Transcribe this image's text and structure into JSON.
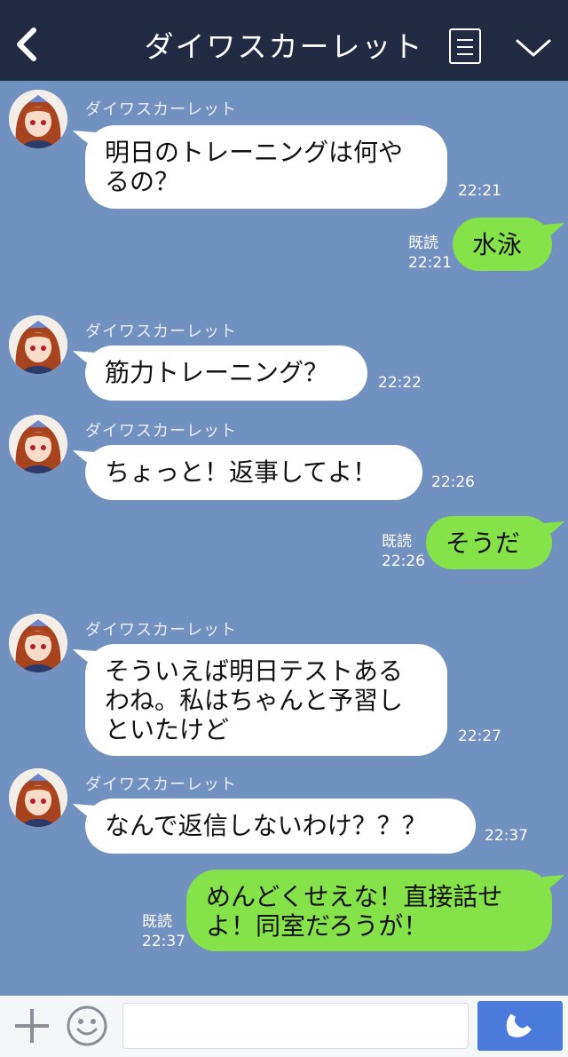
{
  "header": {
    "title": "ダイワスカーレット"
  },
  "messages": {
    "m1": {
      "sender": "ダイワスカーレット",
      "text": "明日のトレーニングは何や\nるの？",
      "time": "22:21"
    },
    "m2": {
      "read": "既読",
      "time": "22:21",
      "text": "水泳"
    },
    "m3": {
      "sender": "ダイワスカーレット",
      "text": "筋力トレーニング？",
      "time": "22:22"
    },
    "m4": {
      "sender": "ダイワスカーレット",
      "text": "ちょっと！返事してよ！",
      "time": "22:26"
    },
    "m5": {
      "read": "既読",
      "time": "22:26",
      "text": "そうだ"
    },
    "m6": {
      "sender": "ダイワスカーレット",
      "text": "そういえば明日テストある\nわね。私はちゃんと予習し\nといたけど",
      "time": "22:27"
    },
    "m7": {
      "sender": "ダイワスカーレット",
      "text": "なんで返信しないわけ？？？",
      "time": "22:37"
    },
    "m8": {
      "read": "既読",
      "time": "22:37",
      "text": "めんどくせえな！直接話せ\nよ！同室だろうが！"
    }
  },
  "input": {
    "value": "",
    "placeholder": ""
  },
  "colors": {
    "header_bg": "#222b42",
    "chat_bg": "#7191c1",
    "incoming_bubble": "#ffffff",
    "outgoing_bubble": "#85e249",
    "call_button": "#4a7bdc"
  },
  "icons": [
    "back-icon",
    "menu-icon",
    "chevron-down-icon",
    "plus-icon",
    "smile-icon",
    "phone-icon"
  ]
}
